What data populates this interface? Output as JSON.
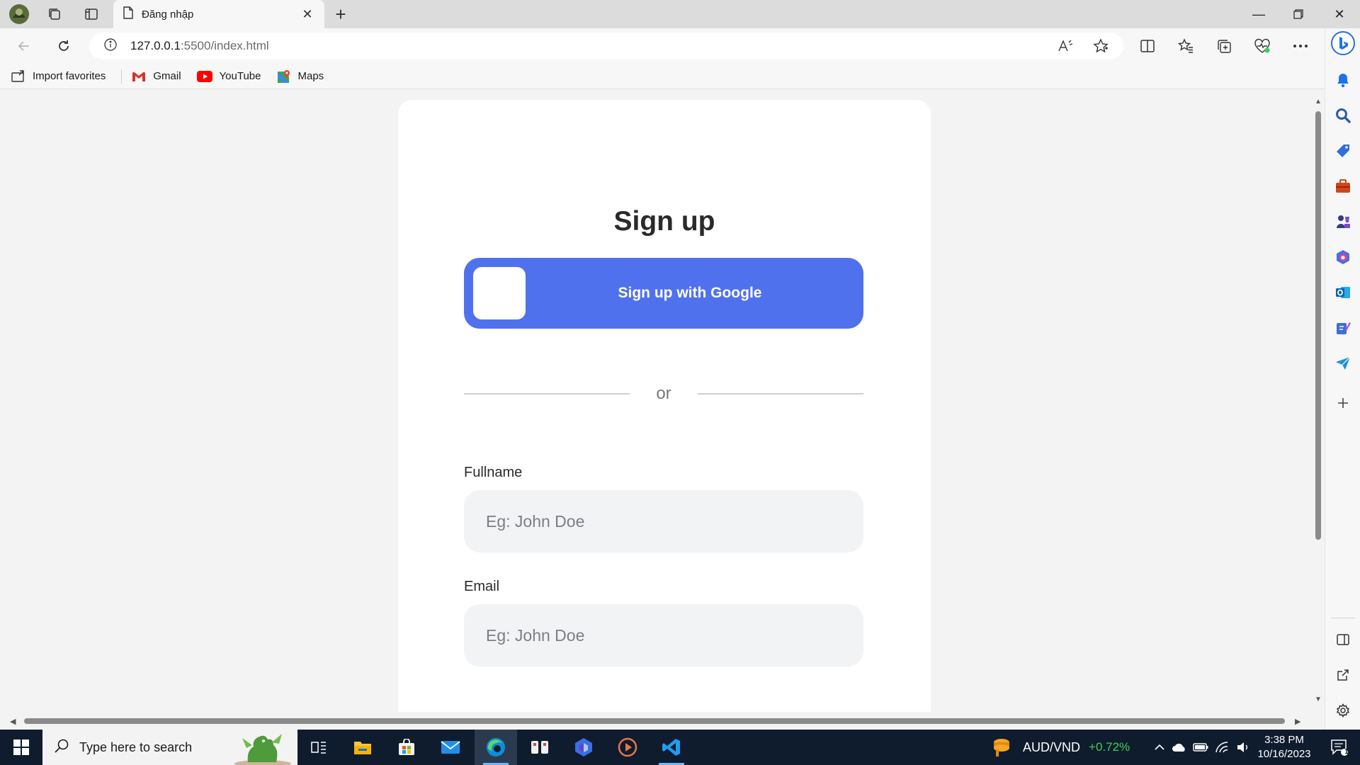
{
  "browser": {
    "tab": {
      "title": "Đăng nhập"
    },
    "url": {
      "host": "127.0.0.1",
      "rest": ":5500/index.html"
    },
    "favorites": [
      {
        "label": "Import favorites",
        "icon": "import-favorites-icon"
      },
      {
        "label": "Gmail",
        "icon": "gmail-icon"
      },
      {
        "label": "YouTube",
        "icon": "youtube-icon"
      },
      {
        "label": "Maps",
        "icon": "maps-icon"
      }
    ]
  },
  "page": {
    "title": "Sign up",
    "google_button": "Sign up with Google",
    "divider_text": "or",
    "fields": [
      {
        "label": "Fullname",
        "placeholder": "Eg: John Doe"
      },
      {
        "label": "Email",
        "placeholder": "Eg: John Doe"
      }
    ]
  },
  "taskbar": {
    "search_placeholder": "Type here to search",
    "widget": {
      "pair": "AUD/VND",
      "change": "+0.72%"
    },
    "clock": {
      "time": "3:38 PM",
      "date": "10/16/2023"
    },
    "notification_count": "1"
  },
  "colors": {
    "accent": "#5071ee",
    "input_bg": "#f2f3f5",
    "taskbar": "#0f1c2e",
    "positive": "#3ccf55"
  }
}
